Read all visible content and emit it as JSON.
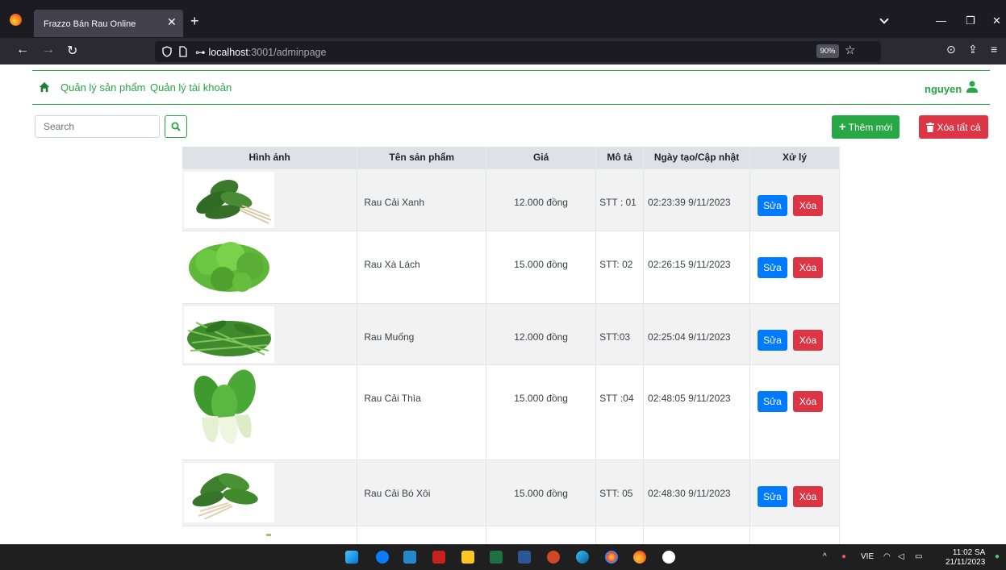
{
  "browser": {
    "tab_title": "Frazzo Bán Rau Online",
    "url_host": "localhost",
    "url_path": ":3001/adminpage",
    "zoom": "90%"
  },
  "nav": {
    "products": "Quản lý sản phẩm",
    "accounts": "Quản lý tài khoản",
    "user": "nguyen"
  },
  "toolbar": {
    "search_placeholder": "Search",
    "add_label": "Thêm mới",
    "delete_all_label": "Xóa tất cả"
  },
  "table": {
    "headers": [
      "Hình ảnh",
      "Tên sản phẩm",
      "Giá",
      "Mô tả",
      "Ngày tạo/Cập nhật",
      "Xử lý"
    ],
    "edit_label": "Sửa",
    "delete_label": "Xóa",
    "rows": [
      {
        "name": "Rau Cải Xanh",
        "price": "12.000 đồng",
        "desc": "STT : 01",
        "date": "02:23:39 9/11/2023"
      },
      {
        "name": "Rau Xà Lách",
        "price": "15.000 đồng",
        "desc": "STT: 02",
        "date": "02:26:15 9/11/2023"
      },
      {
        "name": "Rau Muống",
        "price": "12.000 đồng",
        "desc": "STT:03",
        "date": "02:25:04 9/11/2023"
      },
      {
        "name": "Rau Cải Thìa",
        "price": "15.000 đồng",
        "desc": "STT :04",
        "date": "02:48:05 9/11/2023"
      },
      {
        "name": "Rau Cải Bó Xôi",
        "price": "15.000 đồng",
        "desc": "STT: 05",
        "date": "02:48:30 9/11/2023"
      }
    ]
  },
  "taskbar": {
    "lang": "VIE",
    "time": "11:02 SA",
    "date": "21/11/2023"
  },
  "colors": {
    "green": "#28a745",
    "red": "#dc3545",
    "blue": "#007bff"
  }
}
